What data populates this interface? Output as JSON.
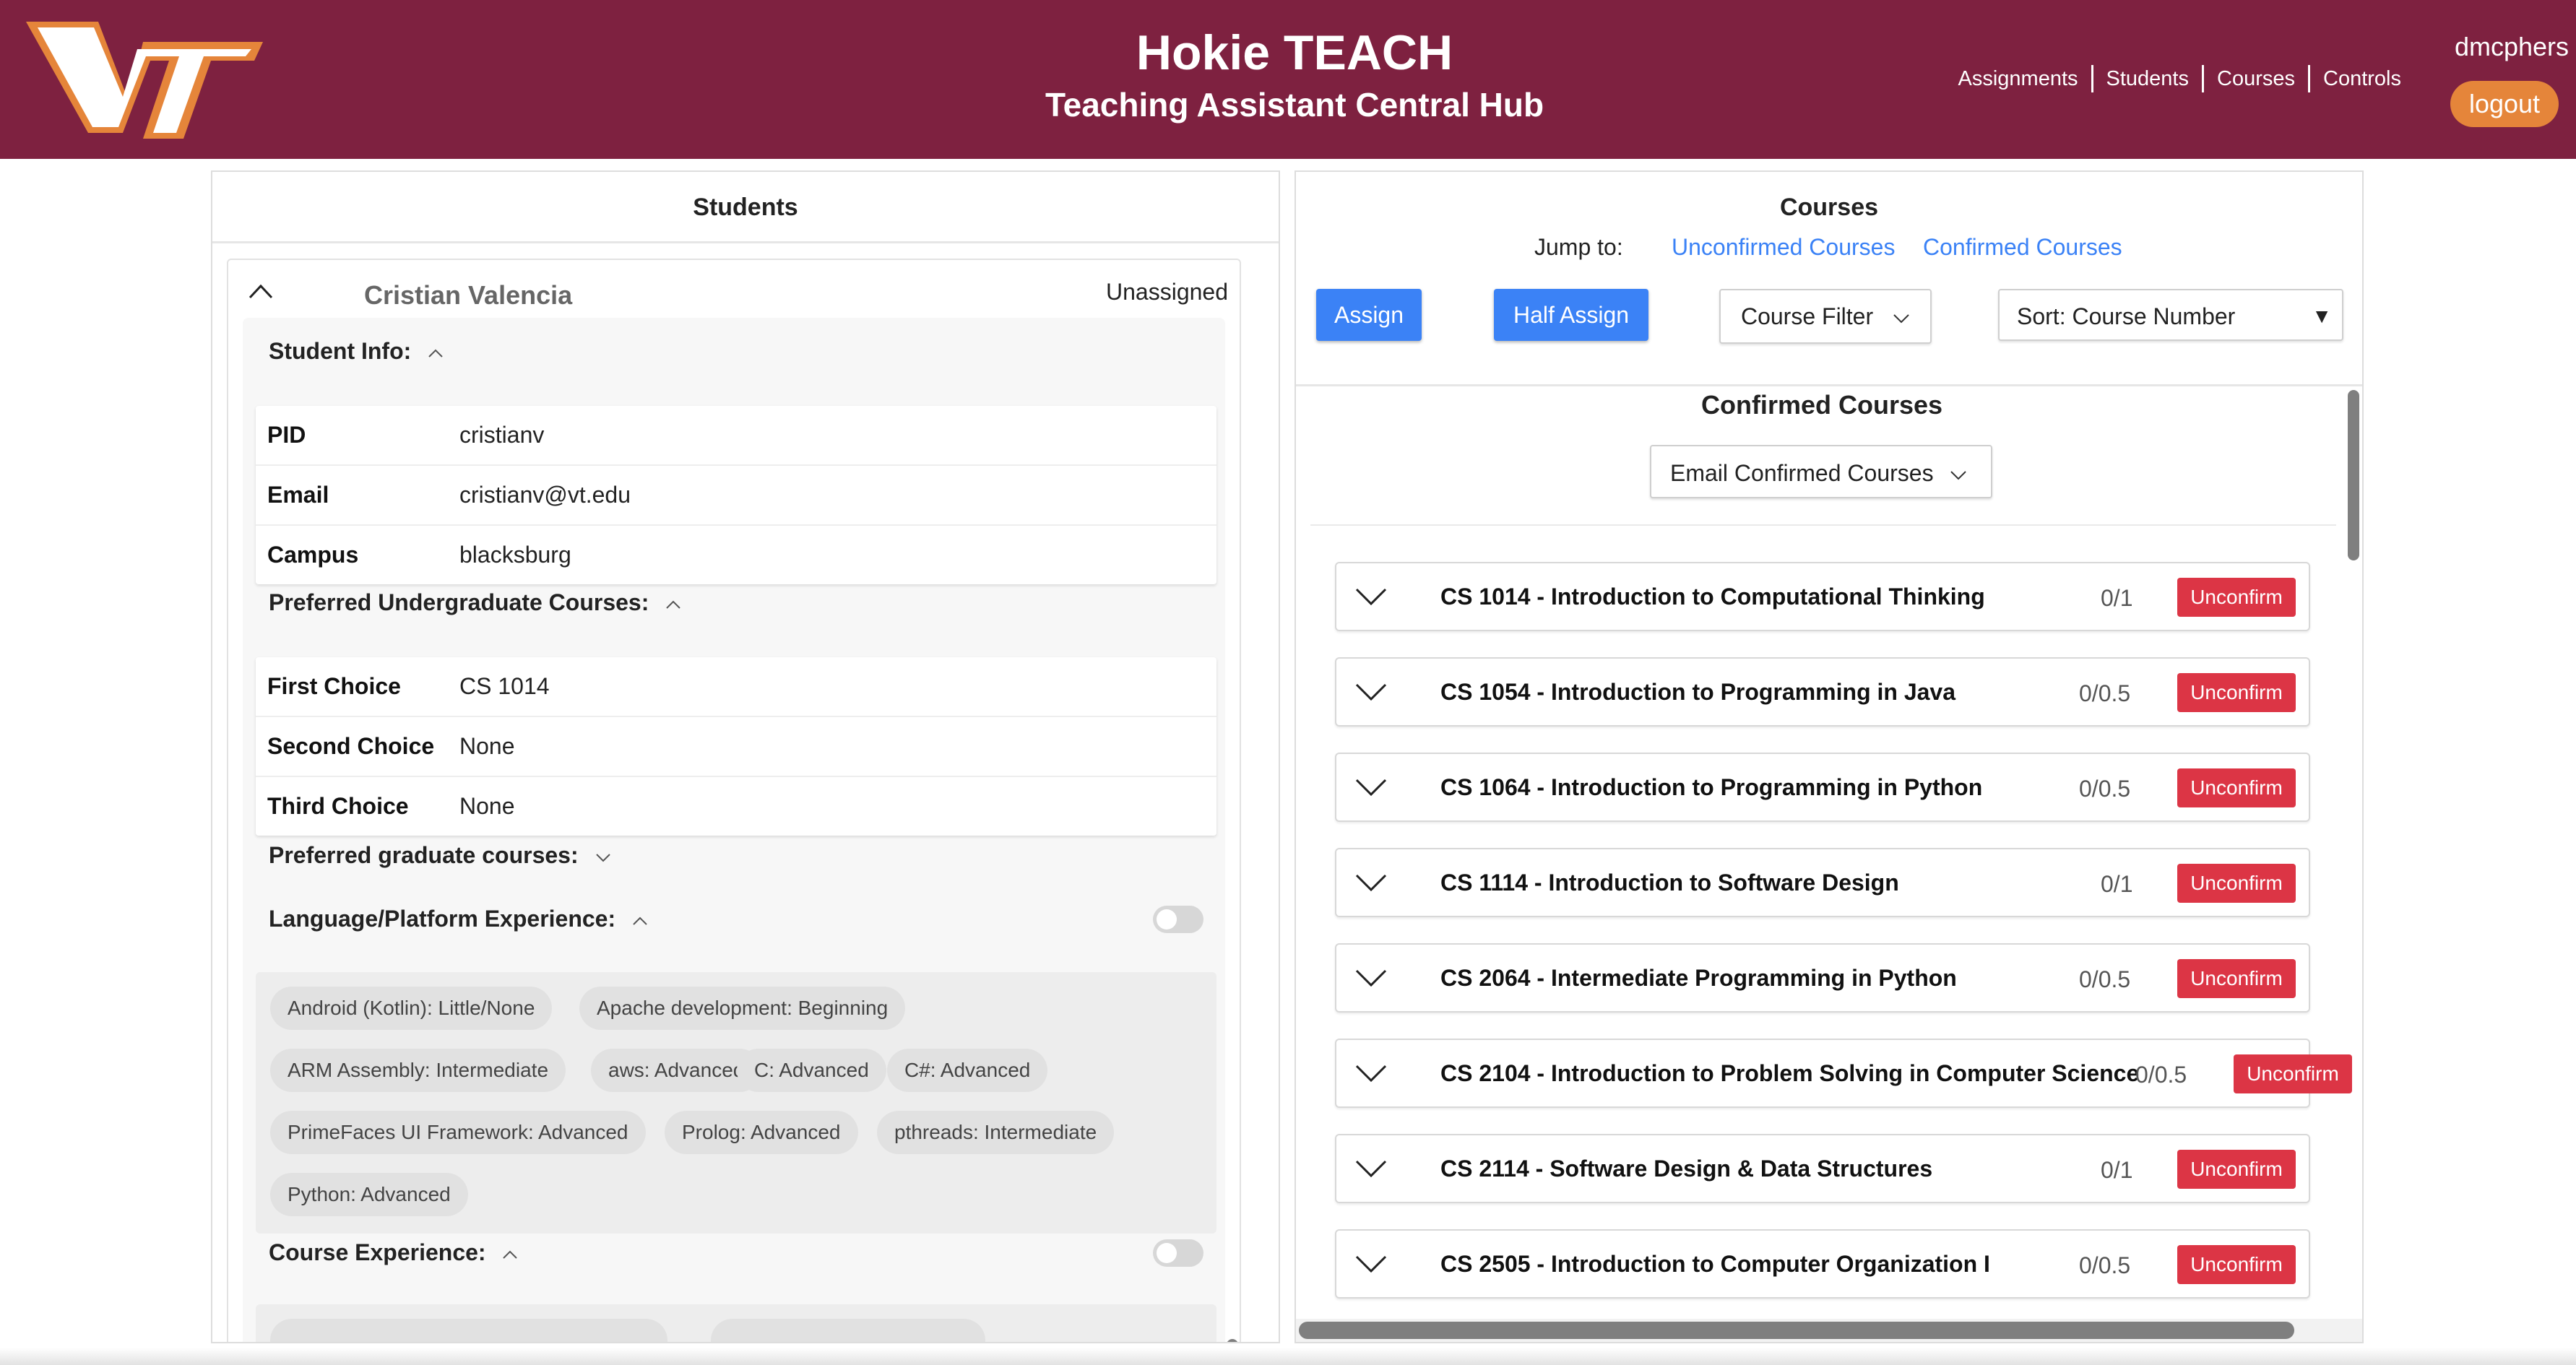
{
  "header": {
    "title": "Hokie TEACH",
    "subtitle": "Teaching Assistant Central Hub",
    "username": "dmcphers",
    "logout_label": "logout",
    "nav": [
      "Assignments",
      "Students",
      "Courses",
      "Controls"
    ]
  },
  "students_panel": {
    "title": "Students",
    "student": {
      "name": "Cristian Valencia",
      "status": "Unassigned",
      "info_label": "Student Info:",
      "info": [
        {
          "key": "PID",
          "value": "cristianv"
        },
        {
          "key": "Email",
          "value": "cristianv@vt.edu"
        },
        {
          "key": "Campus",
          "value": "blacksburg"
        }
      ],
      "undergrad_label": "Preferred Undergraduate Courses:",
      "undergrad": [
        {
          "key": "First Choice",
          "value": "CS 1014"
        },
        {
          "key": "Second Choice",
          "value": "None"
        },
        {
          "key": "Third Choice",
          "value": "None"
        }
      ],
      "grad_label": "Preferred graduate courses:",
      "lang_label": "Language/Platform Experience:",
      "languages": [
        "Android (Kotlin): Little/None",
        "Apache development: Beginning",
        "ARM Assembly: Intermediate",
        "aws: Advanced",
        "C: Advanced",
        "C#: Advanced",
        "PrimeFaces UI Framework: Advanced",
        "Prolog: Advanced",
        "pthreads: Intermediate",
        "Python: Advanced"
      ],
      "course_exp_label": "Course Experience:"
    }
  },
  "courses_panel": {
    "title": "Courses",
    "jump_label": "Jump to:",
    "jump_unconfirmed": "Unconfirmed Courses",
    "jump_confirmed": "Confirmed Courses",
    "assign_label": "Assign",
    "half_assign_label": "Half Assign",
    "filter_label": "Course Filter",
    "sort_label": "Sort: Course Number",
    "confirmed_title": "Confirmed Courses",
    "email_label": "Email Confirmed Courses",
    "unconfirm_label": "Unconfirm",
    "courses": [
      {
        "name": "CS 1014 - Introduction to Computational Thinking",
        "count": "0/1"
      },
      {
        "name": "CS 1054 - Introduction to Programming in Java",
        "count": "0/0.5"
      },
      {
        "name": "CS 1064 - Introduction to Programming in Python",
        "count": "0/0.5"
      },
      {
        "name": "CS 1114 - Introduction to Software Design",
        "count": "0/1"
      },
      {
        "name": "CS 2064 - Intermediate Programming in Python",
        "count": "0/0.5"
      },
      {
        "name": "CS 2104 - Introduction to Problem Solving in Computer Science",
        "count": "0/0.5"
      },
      {
        "name": "CS 2114 - Software Design & Data Structures",
        "count": "0/1"
      },
      {
        "name": "CS 2505 - Introduction to Computer Organization I",
        "count": "0/0.5"
      }
    ]
  },
  "colors": {
    "brand": "#7e2140",
    "logout": "#e5853a",
    "primary": "#3b82f6",
    "danger": "#dc3545"
  }
}
